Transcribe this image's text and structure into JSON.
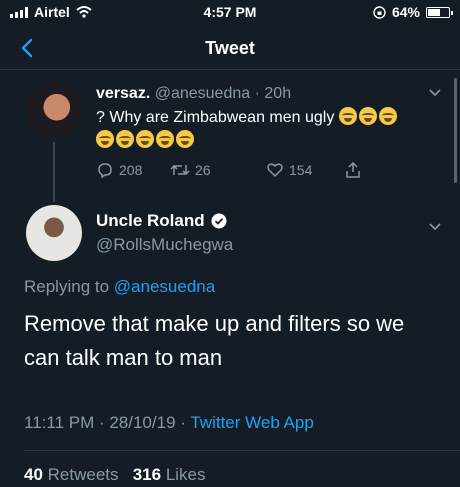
{
  "status_bar": {
    "carrier": "Airtel",
    "time": "4:57 PM",
    "battery": "64%",
    "battery_level": 0.64
  },
  "nav": {
    "title": "Tweet",
    "back_icon": "chevron-left-icon"
  },
  "parent_tweet": {
    "name": "versaz.",
    "handle": "@anesuedna",
    "separator": "·",
    "age": "20h",
    "text": "? Why are Zimbabwean men ugly",
    "emoji_name": "face-with-tears-of-joy",
    "emoji_count_inline": 3,
    "emoji_count_line2": 5,
    "replies": "208",
    "retweets": "26",
    "likes": "154"
  },
  "main_tweet": {
    "name": "Uncle Roland",
    "handle": "@RollsMuchegwa",
    "replying_prefix": "Replying to",
    "replying_to": "@anesuedna",
    "text": "Remove that make up and filters so we can talk man to man",
    "time": "11:11 PM · 28/10/19 ·",
    "source": "Twitter Web App",
    "retweets_count": "40",
    "retweets_label": "Retweets",
    "likes_count": "316",
    "likes_label": "Likes"
  },
  "colors": {
    "background": "#141d26",
    "link": "#1da1f2",
    "secondary_text": "#8899a6"
  }
}
